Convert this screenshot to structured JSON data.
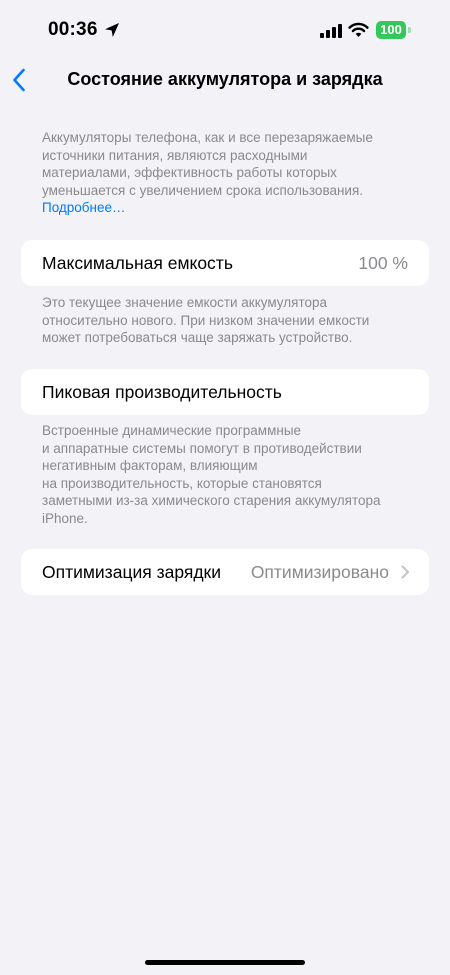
{
  "status_bar": {
    "time": "00:36",
    "battery_level": "100",
    "battery_color": "#34c759"
  },
  "nav": {
    "title": "Состояние аккумулятора и зарядка",
    "back_icon": "chevron-left-icon"
  },
  "intro": {
    "lines": [
      "Аккумуляторы телефона, как и все перезаряжаемые",
      "источники питания, являются расходными",
      "материалами, эффективность работы которых",
      "уменьшается с увеличением срока использования."
    ],
    "link": "Подробнее…"
  },
  "max_capacity": {
    "label": "Максимальная емкость",
    "value": "100 %",
    "footnote_lines": [
      "Это текущее значение емкости аккумулятора",
      "относительно нового. При низком значении емкости",
      "может потребоваться чаще заряжать устройство."
    ]
  },
  "peak_performance": {
    "label": "Пиковая производительность",
    "footnote_lines": [
      "Встроенные динамические программные",
      "и аппаратные системы помогут в противодействии",
      "негативным факторам, влияющим",
      "на производительность, которые становятся",
      "заметными из-за химического старения аккумулятора",
      "iPhone."
    ]
  },
  "charging_optimization": {
    "label": "Оптимизация зарядки",
    "value": "Оптимизировано"
  },
  "colors": {
    "accent": "#007aff",
    "background": "#f2f2f7",
    "secondary_text": "#8a8a8e"
  }
}
